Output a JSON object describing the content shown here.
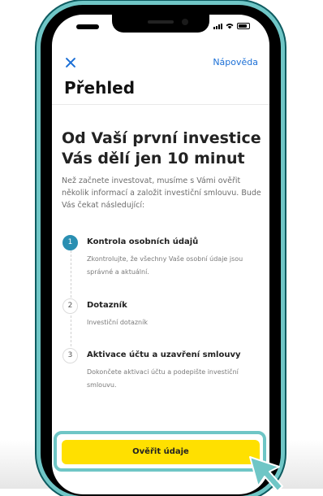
{
  "header": {
    "close_icon": "close-icon",
    "help_label": "Nápověda",
    "title": "Přehled"
  },
  "main": {
    "headline": "Od Vaší první investice Vás dělí jen 10 minut",
    "intro": "Než začnete investovat, musíme s Vámi ověřit několik informací a založit investiční smlouvu. Bude Vás čekat následující:",
    "steps": [
      {
        "number": "1",
        "title": "Kontrola osobních údajů",
        "description": "Zkontrolujte, že všechny Vaše osobní údaje jsou správné a aktuální."
      },
      {
        "number": "2",
        "title": "Dotazník",
        "description": "Investiční dotazník"
      },
      {
        "number": "3",
        "title": "Aktivace účtu a uzavření smlouvy",
        "description": "Dokončete aktivaci účtu a podepište investiční smlouvu."
      }
    ]
  },
  "cta": {
    "label": "Ověřit údaje"
  },
  "colors": {
    "accent": "#1b6fd6",
    "step_active": "#2a8fb2",
    "cta": "#ffe000",
    "highlight": "#6fc6c6"
  }
}
